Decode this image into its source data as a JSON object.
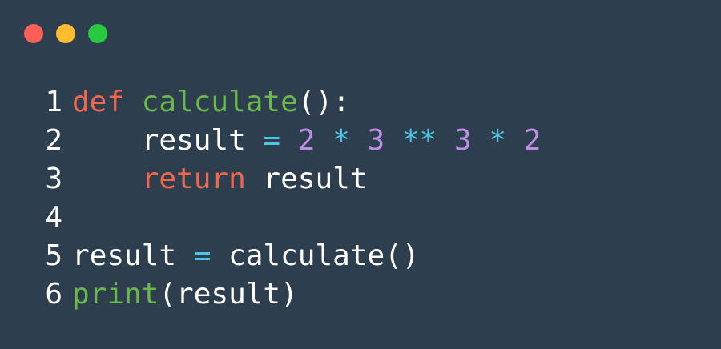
{
  "window": {
    "controls": [
      "close",
      "minimize",
      "maximize"
    ],
    "colors": {
      "background": "#2d3e4f",
      "close": "#fe5f57",
      "minimize": "#febc2e",
      "maximize": "#28c840",
      "keyword": "#f0664e",
      "function": "#6bb94b",
      "operator": "#4cc7e6",
      "number": "#bf8ce6",
      "text": "#ffffff"
    }
  },
  "code": {
    "lines": [
      {
        "number": "1",
        "tokens": [
          {
            "text": "def",
            "type": "kw"
          },
          {
            "text": " ",
            "type": "pl"
          },
          {
            "text": "calculate",
            "type": "fn"
          },
          {
            "text": "():",
            "type": "pl"
          }
        ]
      },
      {
        "number": "2",
        "tokens": [
          {
            "text": "    result ",
            "type": "pl"
          },
          {
            "text": "=",
            "type": "op"
          },
          {
            "text": " ",
            "type": "pl"
          },
          {
            "text": "2",
            "type": "num"
          },
          {
            "text": " ",
            "type": "pl"
          },
          {
            "text": "*",
            "type": "op"
          },
          {
            "text": " ",
            "type": "pl"
          },
          {
            "text": "3",
            "type": "num"
          },
          {
            "text": " ",
            "type": "pl"
          },
          {
            "text": "**",
            "type": "op"
          },
          {
            "text": " ",
            "type": "pl"
          },
          {
            "text": "3",
            "type": "num"
          },
          {
            "text": " ",
            "type": "pl"
          },
          {
            "text": "*",
            "type": "op"
          },
          {
            "text": " ",
            "type": "pl"
          },
          {
            "text": "2",
            "type": "num"
          }
        ]
      },
      {
        "number": "3",
        "tokens": [
          {
            "text": "    ",
            "type": "pl"
          },
          {
            "text": "return",
            "type": "kw"
          },
          {
            "text": " result",
            "type": "pl"
          }
        ]
      },
      {
        "number": "4",
        "tokens": []
      },
      {
        "number": "5",
        "tokens": [
          {
            "text": "result ",
            "type": "pl"
          },
          {
            "text": "=",
            "type": "op"
          },
          {
            "text": " calculate()",
            "type": "pl"
          }
        ]
      },
      {
        "number": "6",
        "tokens": [
          {
            "text": "print",
            "type": "fn"
          },
          {
            "text": "(result)",
            "type": "pl"
          }
        ]
      }
    ]
  }
}
